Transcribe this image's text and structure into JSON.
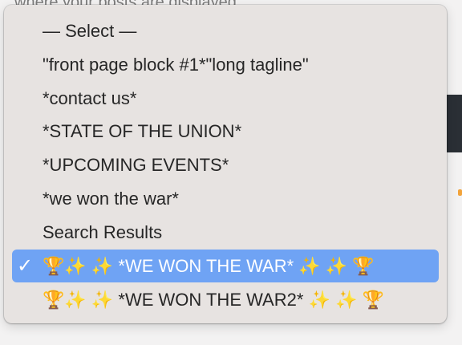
{
  "background": {
    "text": "where your posts are displayed"
  },
  "menu": {
    "items": [
      {
        "label": "— Select —",
        "selected": false
      },
      {
        "label": "\"front page block #1*\"long tagline\"",
        "selected": false
      },
      {
        "label": "*contact us*",
        "selected": false
      },
      {
        "label": "*STATE OF THE UNION*",
        "selected": false
      },
      {
        "label": "*UPCOMING EVENTS*",
        "selected": false
      },
      {
        "label": "*we won the war*",
        "selected": false
      },
      {
        "label": "Search Results",
        "selected": false
      },
      {
        "label": "🏆✨ ✨ *WE WON THE WAR* ✨ ✨ 🏆",
        "selected": true
      },
      {
        "label": "🏆✨ ✨ *WE WON THE WAR2* ✨ ✨ 🏆",
        "selected": false
      }
    ],
    "selected_mark": "✓"
  },
  "colors": {
    "menu_background": "#e7e3e1",
    "selection_highlight": "#6fa3f4",
    "text": "#262626"
  }
}
